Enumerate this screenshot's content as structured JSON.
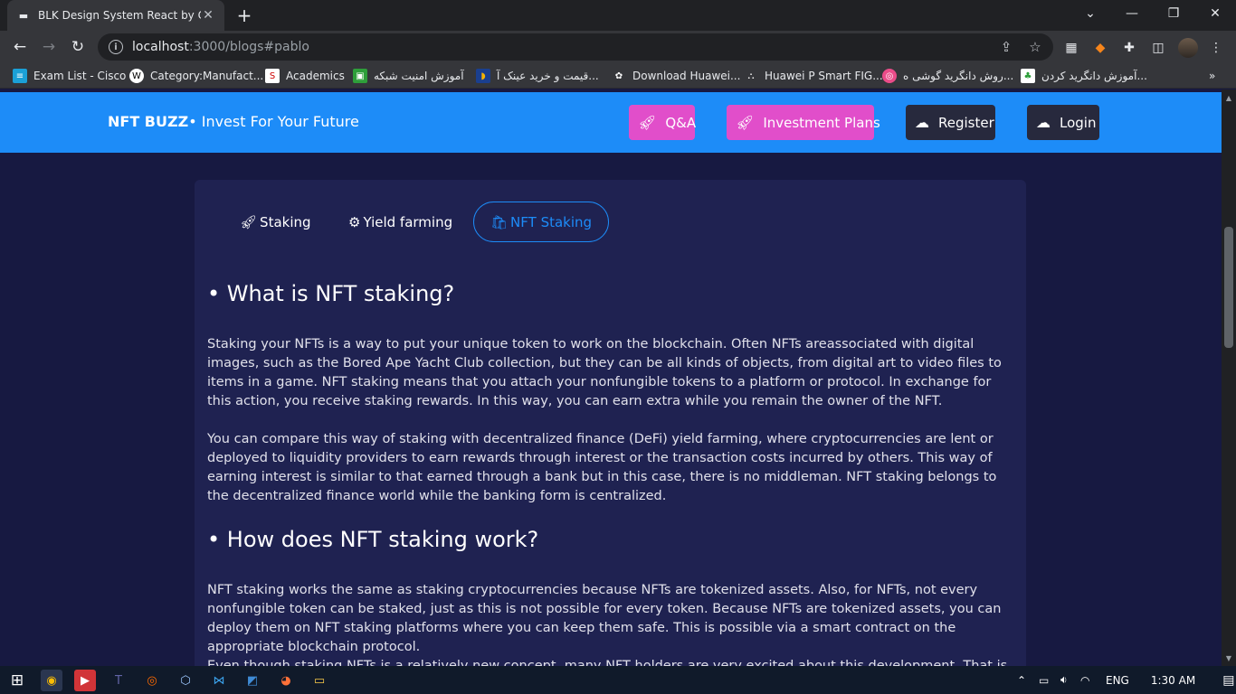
{
  "browser": {
    "tab_title": "BLK Design System React by Crea",
    "url_host": "localhost",
    "url_rest": ":3000/blogs#pablo",
    "bookmarks": [
      {
        "label": "Exam List - Cisco",
        "icon": "cisco-icon"
      },
      {
        "label": "Category:Manufact...",
        "icon": "wikipedia-icon"
      },
      {
        "label": "Academics",
        "icon": "s-logo-icon"
      },
      {
        "label": "آموزش امنیت شبکه",
        "icon": "green-logo-icon"
      },
      {
        "label": "قیمت و خرید عینک آ...",
        "icon": "glasses-icon"
      },
      {
        "label": "Download Huawei...",
        "icon": "huawei-icon"
      },
      {
        "label": "Huawei P Smart FIG...",
        "icon": "bookmark-icon"
      },
      {
        "label": "روش دانگرید گوشی ه...",
        "icon": "dribbble-icon"
      },
      {
        "label": "آموزش دانگرید کردن...",
        "icon": "page-icon"
      }
    ]
  },
  "navbar": {
    "brand_bold": "NFT BUZZ",
    "brand_rest": "• Invest For Your Future",
    "buttons": [
      {
        "label": "Q&A",
        "icon": "rocket-icon"
      },
      {
        "label": "Investment Plans",
        "icon": "rocket-icon"
      },
      {
        "label": "Register",
        "icon": "cloud-upload-icon"
      },
      {
        "label": "Login",
        "icon": "cloud-upload-icon"
      }
    ]
  },
  "tabs": [
    {
      "label": "Staking",
      "icon": "rocket-icon"
    },
    {
      "label": "Yield farming",
      "icon": "gear-icon"
    },
    {
      "label": "NFT Staking",
      "icon": "bag-icon",
      "active": true
    }
  ],
  "content": {
    "h1": "• What is NFT staking?",
    "p1": "Staking your NFTs is a way to put your unique token to work on the blockchain. Often NFTs areassociated with digital images, such as the Bored Ape Yacht Club collection, but they can be all kinds of objects, from digital art to video files to items in a game. NFT staking means that you attach your nonfungible tokens to a platform or protocol. In exchange for this action, you receive staking rewards. In this way, you can earn extra while you remain the owner of the NFT.",
    "p2": "You can compare this way of staking with decentralized finance (DeFi) yield farming, where cryptocurrencies are lent or deployed to liquidity providers to earn rewards through interest or the transaction costs incurred by others. This way of earning interest is similar to that earned through a bank but in this case, there is no middleman. NFT staking belongs to the decentralized finance world while the banking form is centralized.",
    "h2": "• How does NFT staking work?",
    "p3": "NFT staking works the same as staking cryptocurrencies because NFTs are tokenized assets. Also, for NFTs, not every nonfungible token can be staked, just as this is not possible for every token. Because NFTs are tokenized assets, you can deploy them on NFT staking platforms where you can keep them safe. This is possible via a smart contract on the appropriate blockchain protocol.",
    "p4": "Even though staking NFTs is a relatively new concept, many NFT holders are very excited about this development. That is"
  },
  "taskbar": {
    "language": "ENG",
    "time": "1:30 AM"
  }
}
